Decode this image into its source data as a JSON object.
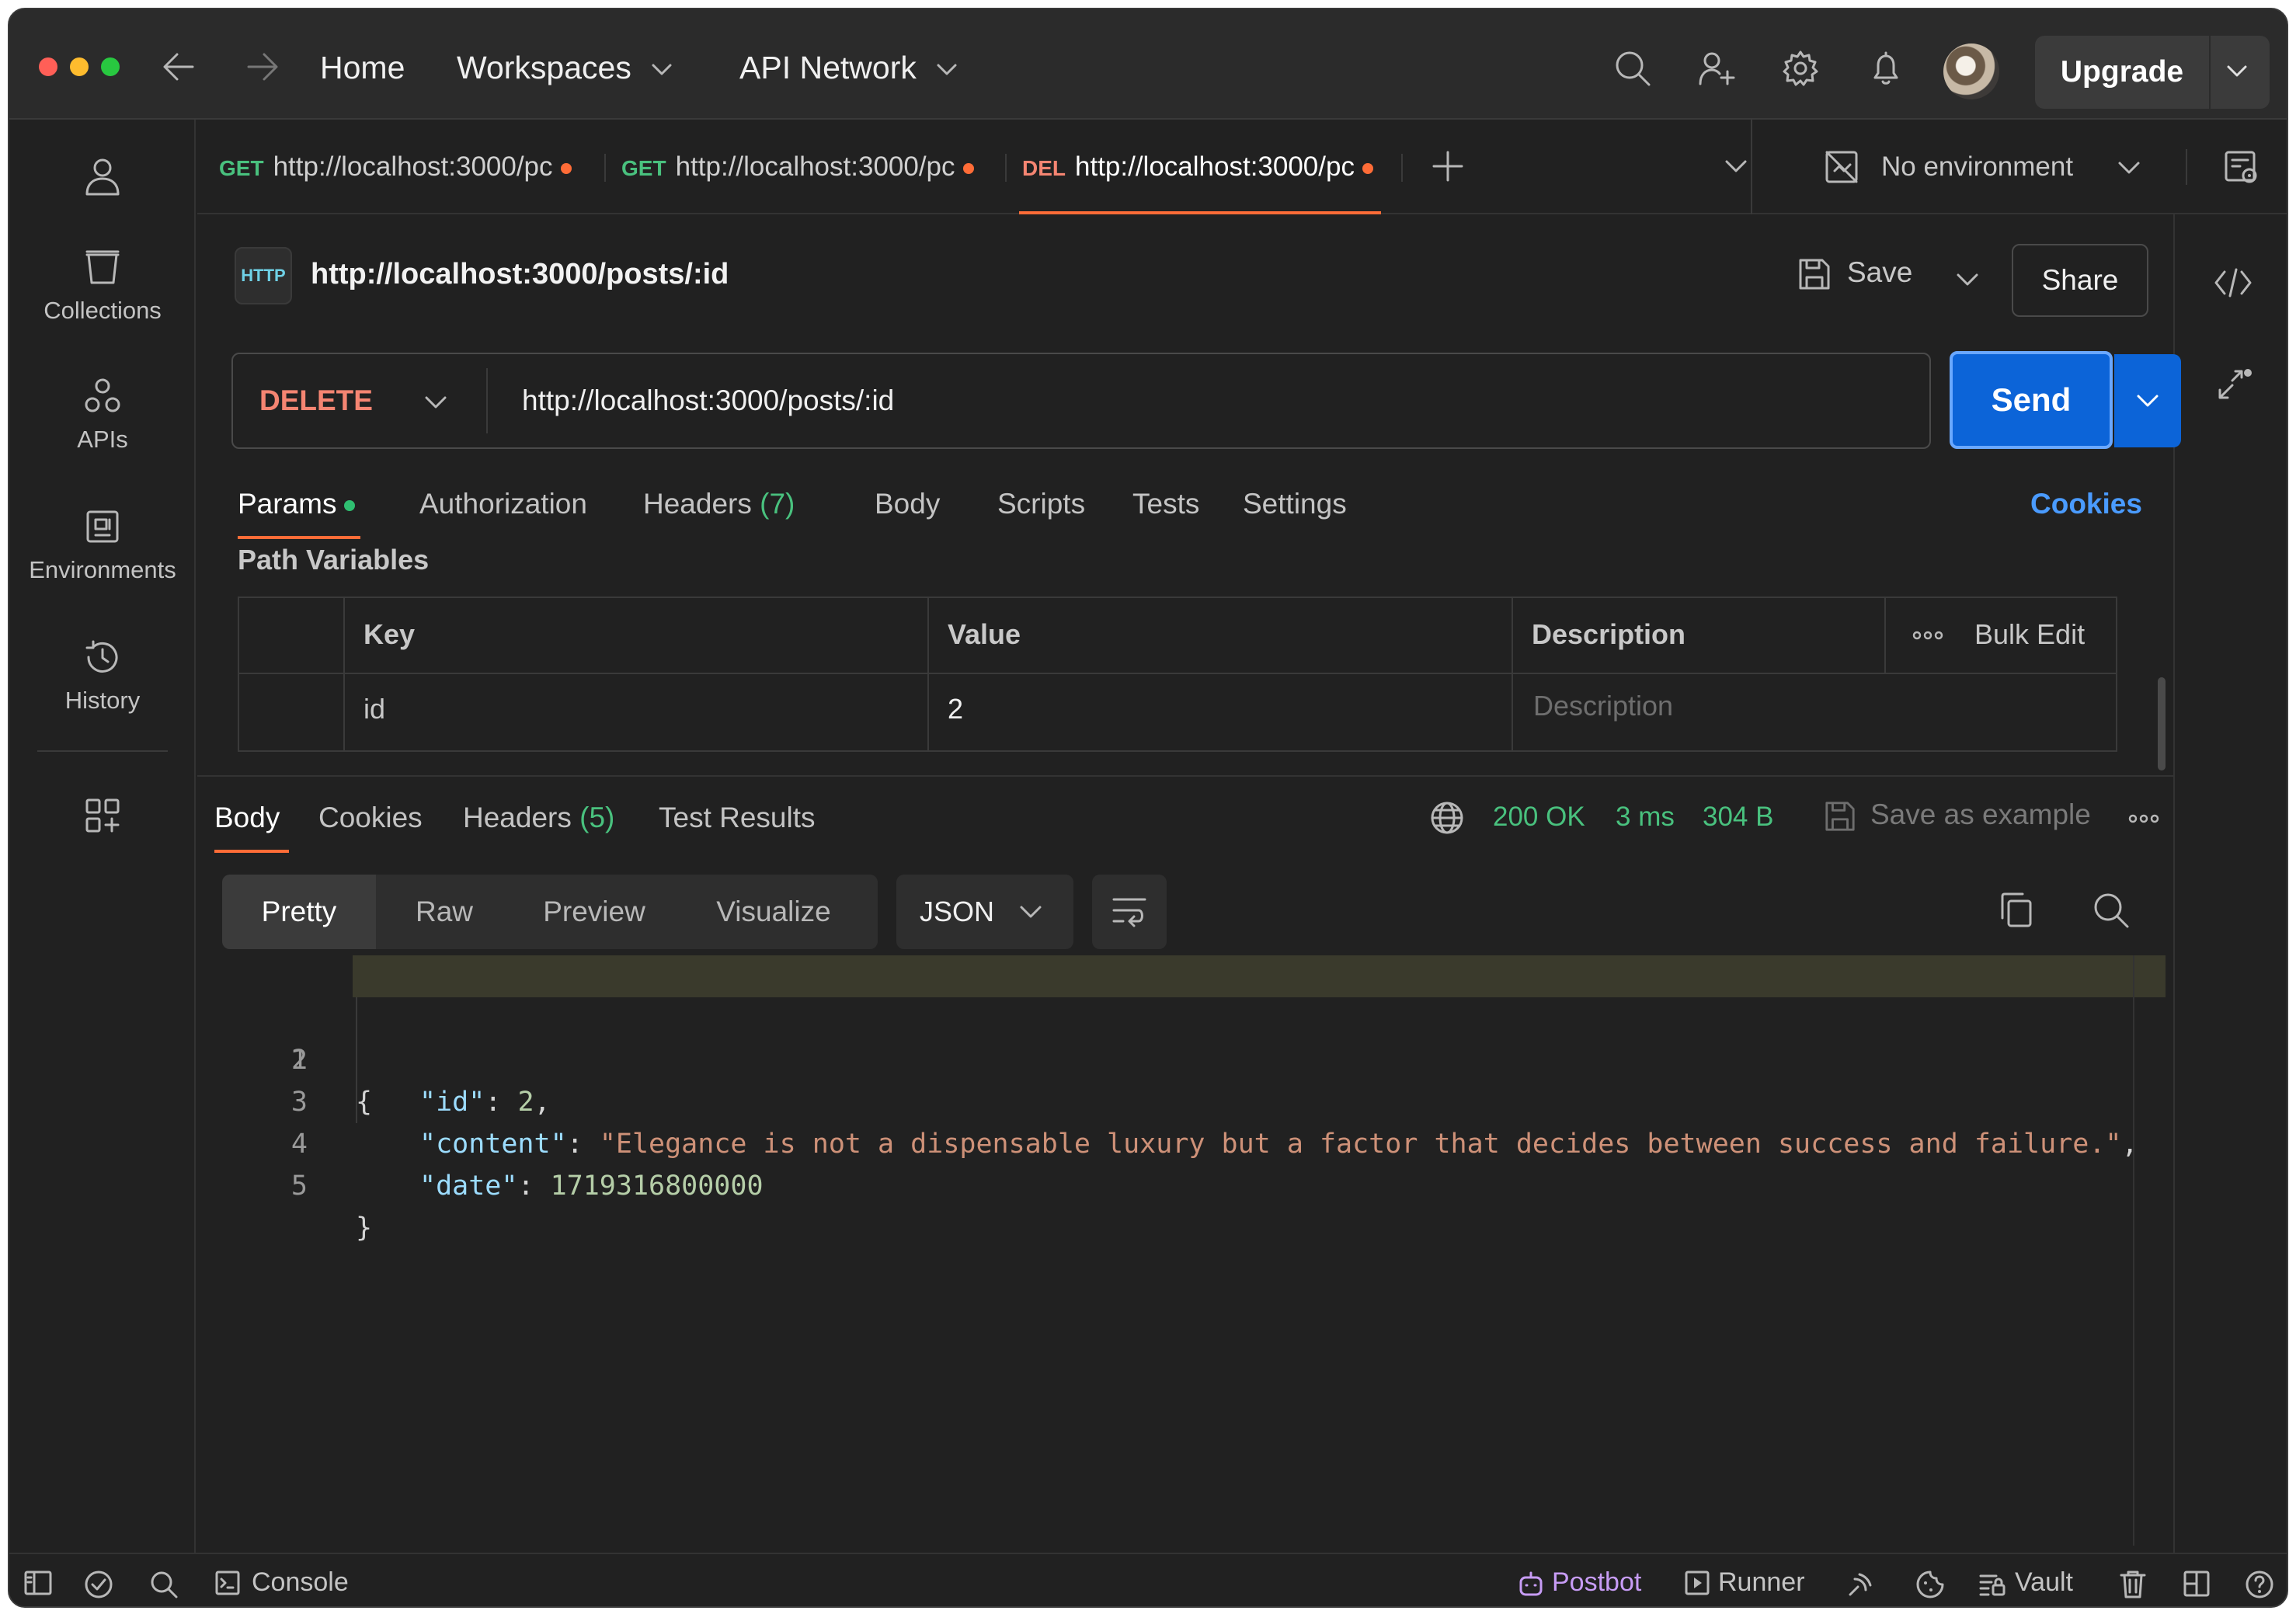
{
  "topbar": {
    "home": "Home",
    "workspaces": "Workspaces",
    "api_network": "API Network",
    "upgrade": "Upgrade"
  },
  "sidebar": {
    "items": [
      {
        "label": "Collections",
        "icon": "collections-icon"
      },
      {
        "label": "APIs",
        "icon": "apis-icon"
      },
      {
        "label": "Environments",
        "icon": "environments-icon"
      },
      {
        "label": "History",
        "icon": "history-icon"
      }
    ]
  },
  "tabs": [
    {
      "method": "GET",
      "url": "http://localhost:3000/pc",
      "method_color": "#49c17e"
    },
    {
      "method": "GET",
      "url": "http://localhost:3000/pc",
      "method_color": "#49c17e"
    },
    {
      "method": "DEL",
      "url": "http://localhost:3000/pc",
      "method_color": "#f58572"
    }
  ],
  "environment": "No environment",
  "request": {
    "badge": "HTTP",
    "title": "http://localhost:3000/posts/:id",
    "save": "Save",
    "share": "Share",
    "method": "DELETE",
    "url": "http://localhost:3000/posts/:id",
    "send": "Send",
    "tabs": {
      "params": "Params",
      "authorization": "Authorization",
      "headers": "Headers",
      "headers_count": "(7)",
      "body": "Body",
      "scripts": "Scripts",
      "tests": "Tests",
      "settings": "Settings",
      "cookies": "Cookies"
    },
    "path_variables": {
      "title": "Path Variables",
      "headers": {
        "key": "Key",
        "value": "Value",
        "description": "Description",
        "bulk_edit": "Bulk Edit"
      },
      "rows": [
        {
          "key": "id",
          "value": "2",
          "description_placeholder": "Description"
        }
      ]
    }
  },
  "response": {
    "tabs": {
      "body": "Body",
      "cookies": "Cookies",
      "headers": "Headers",
      "headers_count": "(5)",
      "test_results": "Test Results"
    },
    "status": "200 OK",
    "time": "3 ms",
    "size": "304 B",
    "save_as_example": "Save as example",
    "views": [
      "Pretty",
      "Raw",
      "Preview",
      "Visualize"
    ],
    "format": "JSON",
    "code": {
      "line_numbers": [
        "1",
        "2",
        "3",
        "4",
        "5"
      ],
      "open_brace": "{",
      "close_brace": "}",
      "fields": [
        {
          "key": "\"id\"",
          "value": "2",
          "type": "number",
          "comma": ","
        },
        {
          "key": "\"content\"",
          "value": "\"Elegance is not a dispensable luxury but a factor that decides between success and failure.\"",
          "type": "string",
          "comma": ","
        },
        {
          "key": "\"date\"",
          "value": "1719316800000",
          "type": "number",
          "comma": ""
        }
      ]
    }
  },
  "statusbar": {
    "console": "Console",
    "postbot": "Postbot",
    "runner": "Runner",
    "vault": "Vault"
  },
  "colors": {
    "accent": "#ff6c37",
    "send": "#0c64d8",
    "success": "#49c17e",
    "link": "#4a9bff"
  }
}
